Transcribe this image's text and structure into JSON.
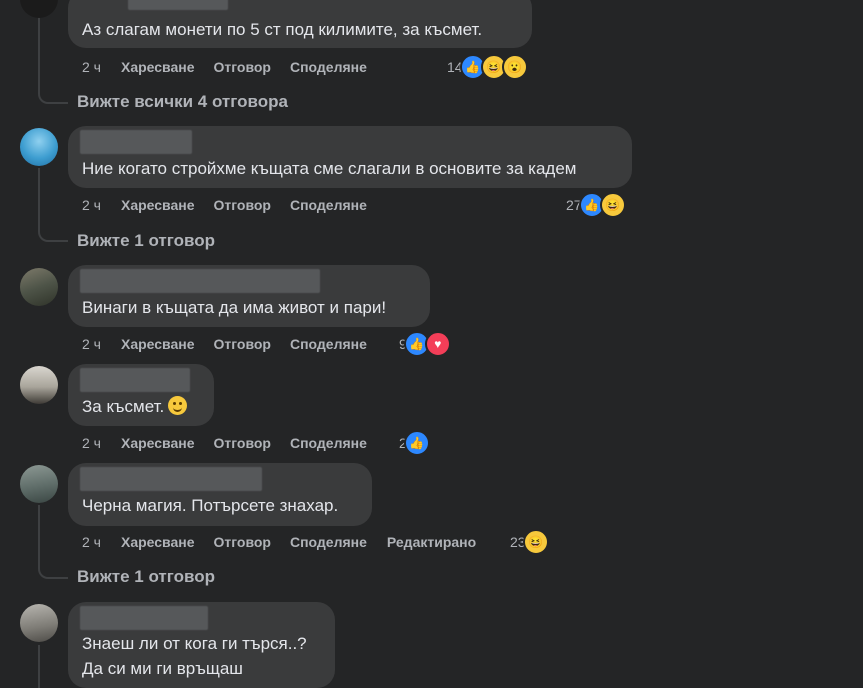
{
  "comments": [
    {
      "text": "Аз слагам монети по 5 ст под килимите, за късмет.",
      "time": "2 ч",
      "like": "Харесване",
      "reply": "Отговор",
      "share": "Споделяне",
      "reactions": {
        "count": "14",
        "types": [
          "like-icon",
          "haha-icon",
          "wow-icon"
        ]
      },
      "view_replies": "Вижте всички 4 отговора"
    },
    {
      "text": "Ние когато стройхме къщата сме слагали в основите за кадем",
      "time": "2 ч",
      "like": "Харесване",
      "reply": "Отговор",
      "share": "Споделяне",
      "reactions": {
        "count": "27",
        "types": [
          "like-icon",
          "haha-icon"
        ]
      },
      "view_replies": "Вижте 1 отговор"
    },
    {
      "text": "Винаги в къщата да има живот и пари!",
      "time": "2 ч",
      "like": "Харесване",
      "reply": "Отговор",
      "share": "Споделяне",
      "reactions": {
        "count": "9",
        "types": [
          "like-icon",
          "love-icon"
        ]
      }
    },
    {
      "text": "За късмет.",
      "time": "2 ч",
      "like": "Харесване",
      "reply": "Отговор",
      "share": "Споделяне",
      "reactions": {
        "count": "2",
        "types": [
          "like-icon"
        ]
      }
    },
    {
      "text": "Черна магия. Потърсете знахар.",
      "time": "2 ч",
      "like": "Харесване",
      "reply": "Отговор",
      "share": "Споделяне",
      "edited": "Редактирано",
      "reactions": {
        "count": "23",
        "types": [
          "haha-icon"
        ]
      },
      "view_replies": "Вижте 1 отговор"
    },
    {
      "text_line1": "Знаеш ли от кога ги търся..?",
      "text_line2": "Да си ми ги връщаш"
    }
  ],
  "colors": {
    "background": "#242526",
    "bubble": "#3a3b3c",
    "text": "#e4e6eb",
    "muted": "#b0b3b8",
    "like": "#2d88ff",
    "love": "#f33e58",
    "haha": "#f7c93c"
  }
}
